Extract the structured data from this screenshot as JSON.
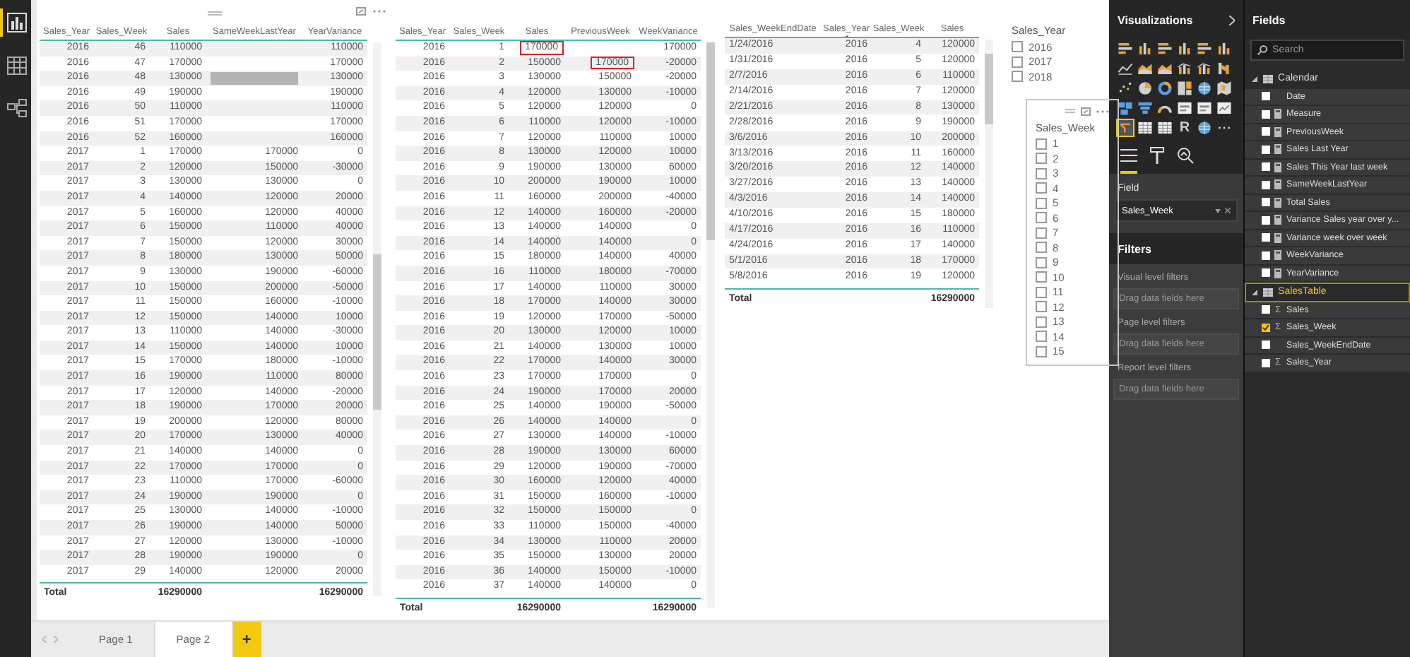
{
  "nav": [
    {
      "kind": "report",
      "selected": true
    },
    {
      "kind": "data",
      "selected": false
    },
    {
      "kind": "model",
      "selected": false
    }
  ],
  "left_table": {
    "columns": [
      {
        "label": "Sales_Year"
      },
      {
        "label": "Sales_Week"
      },
      {
        "label": "Sales"
      },
      {
        "label": "SameWeekLastYear"
      },
      {
        "label": "YearVariance"
      }
    ],
    "rows": [
      {
        "cells": [
          "2016",
          "46",
          "110000",
          null,
          "110000"
        ]
      },
      {
        "cells": [
          "2016",
          "47",
          "170000",
          null,
          "170000"
        ]
      },
      {
        "cells": [
          "2016",
          "48",
          "130000",
          {
            "highlighted": true
          },
          "130000"
        ]
      },
      {
        "cells": [
          "2016",
          "49",
          "190000",
          null,
          "190000"
        ]
      },
      {
        "cells": [
          "2016",
          "50",
          "110000",
          null,
          "110000"
        ]
      },
      {
        "cells": [
          "2016",
          "51",
          "170000",
          null,
          "170000"
        ]
      },
      {
        "cells": [
          "2016",
          "52",
          "160000",
          null,
          "160000"
        ]
      },
      {
        "cells": [
          "2017",
          "1",
          "170000",
          "170000",
          "0"
        ]
      },
      {
        "cells": [
          "2017",
          "2",
          "120000",
          "150000",
          "-30000"
        ]
      },
      {
        "cells": [
          "2017",
          "3",
          "130000",
          "130000",
          "0"
        ]
      },
      {
        "cells": [
          "2017",
          "4",
          "140000",
          "120000",
          "20000"
        ]
      },
      {
        "cells": [
          "2017",
          "5",
          "160000",
          "120000",
          "40000"
        ]
      },
      {
        "cells": [
          "2017",
          "6",
          "150000",
          "110000",
          "40000"
        ]
      },
      {
        "cells": [
          "2017",
          "7",
          "150000",
          "120000",
          "30000"
        ]
      },
      {
        "cells": [
          "2017",
          "8",
          "180000",
          "130000",
          "50000"
        ]
      },
      {
        "cells": [
          "2017",
          "9",
          "130000",
          "190000",
          "-60000"
        ]
      },
      {
        "cells": [
          "2017",
          "10",
          "150000",
          "200000",
          "-50000"
        ]
      },
      {
        "cells": [
          "2017",
          "11",
          "150000",
          "160000",
          "-10000"
        ]
      },
      {
        "cells": [
          "2017",
          "12",
          "150000",
          "140000",
          "10000"
        ]
      },
      {
        "cells": [
          "2017",
          "13",
          "110000",
          "140000",
          "-30000"
        ]
      },
      {
        "cells": [
          "2017",
          "14",
          "150000",
          "140000",
          "10000"
        ]
      },
      {
        "cells": [
          "2017",
          "15",
          "170000",
          "180000",
          "-10000"
        ]
      },
      {
        "cells": [
          "2017",
          "16",
          "190000",
          "110000",
          "80000"
        ]
      },
      {
        "cells": [
          "2017",
          "17",
          "120000",
          "140000",
          "-20000"
        ]
      },
      {
        "cells": [
          "2017",
          "18",
          "190000",
          "170000",
          "20000"
        ]
      },
      {
        "cells": [
          "2017",
          "19",
          "200000",
          "120000",
          "80000"
        ]
      },
      {
        "cells": [
          "2017",
          "20",
          "170000",
          "130000",
          "40000"
        ]
      },
      {
        "cells": [
          "2017",
          "21",
          "140000",
          "140000",
          "0"
        ]
      },
      {
        "cells": [
          "2017",
          "22",
          "170000",
          "170000",
          "0"
        ]
      },
      {
        "cells": [
          "2017",
          "23",
          "110000",
          "170000",
          "-60000"
        ]
      },
      {
        "cells": [
          "2017",
          "24",
          "190000",
          "190000",
          "0"
        ]
      },
      {
        "cells": [
          "2017",
          "25",
          "130000",
          "140000",
          "-10000"
        ]
      },
      {
        "cells": [
          "2017",
          "26",
          "190000",
          "140000",
          "50000"
        ]
      },
      {
        "cells": [
          "2017",
          "27",
          "120000",
          "130000",
          "-10000"
        ]
      },
      {
        "cells": [
          "2017",
          "28",
          "190000",
          "190000",
          "0"
        ]
      },
      {
        "cells": [
          "2017",
          "29",
          "140000",
          "120000",
          "20000"
        ]
      }
    ],
    "total": {
      "label": "Total",
      "sales": "16290000",
      "variance": "16290000"
    }
  },
  "middle_table": {
    "columns": [
      {
        "label": "Sales_Year"
      },
      {
        "label": "Sales_Week"
      },
      {
        "label": "Sales"
      },
      {
        "label": "PreviousWeek"
      },
      {
        "label": "WeekVariance"
      }
    ],
    "rows": [
      {
        "cells": [
          "2016",
          "1",
          {
            "text": "170000",
            "boxed": true
          },
          null,
          "170000"
        ]
      },
      {
        "cells": [
          "2016",
          "2",
          "150000",
          {
            "text": "170000",
            "boxed": true
          },
          "-20000"
        ]
      },
      {
        "cells": [
          "2016",
          "3",
          "130000",
          "150000",
          "-20000"
        ]
      },
      {
        "cells": [
          "2016",
          "4",
          "120000",
          "130000",
          "-10000"
        ]
      },
      {
        "cells": [
          "2016",
          "5",
          "120000",
          "120000",
          "0"
        ]
      },
      {
        "cells": [
          "2016",
          "6",
          "110000",
          "120000",
          "-10000"
        ]
      },
      {
        "cells": [
          "2016",
          "7",
          "120000",
          "110000",
          "10000"
        ]
      },
      {
        "cells": [
          "2016",
          "8",
          "130000",
          "120000",
          "10000"
        ]
      },
      {
        "cells": [
          "2016",
          "9",
          "190000",
          "130000",
          "60000"
        ]
      },
      {
        "cells": [
          "2016",
          "10",
          "200000",
          "190000",
          "10000"
        ]
      },
      {
        "cells": [
          "2016",
          "11",
          "160000",
          "200000",
          "-40000"
        ]
      },
      {
        "cells": [
          "2016",
          "12",
          "140000",
          "160000",
          "-20000"
        ]
      },
      {
        "cells": [
          "2016",
          "13",
          "140000",
          "140000",
          "0"
        ]
      },
      {
        "cells": [
          "2016",
          "14",
          "140000",
          "140000",
          "0"
        ]
      },
      {
        "cells": [
          "2016",
          "15",
          "180000",
          "140000",
          "40000"
        ]
      },
      {
        "cells": [
          "2016",
          "16",
          "110000",
          "180000",
          "-70000"
        ]
      },
      {
        "cells": [
          "2016",
          "17",
          "140000",
          "110000",
          "30000"
        ]
      },
      {
        "cells": [
          "2016",
          "18",
          "170000",
          "140000",
          "30000"
        ]
      },
      {
        "cells": [
          "2016",
          "19",
          "120000",
          "170000",
          "-50000"
        ]
      },
      {
        "cells": [
          "2016",
          "20",
          "130000",
          "120000",
          "10000"
        ]
      },
      {
        "cells": [
          "2016",
          "21",
          "140000",
          "130000",
          "10000"
        ]
      },
      {
        "cells": [
          "2016",
          "22",
          "170000",
          "140000",
          "30000"
        ]
      },
      {
        "cells": [
          "2016",
          "23",
          "170000",
          "170000",
          "0"
        ]
      },
      {
        "cells": [
          "2016",
          "24",
          "190000",
          "170000",
          "20000"
        ]
      },
      {
        "cells": [
          "2016",
          "25",
          "140000",
          "190000",
          "-50000"
        ]
      },
      {
        "cells": [
          "2016",
          "26",
          "140000",
          "140000",
          "0"
        ]
      },
      {
        "cells": [
          "2016",
          "27",
          "130000",
          "140000",
          "-10000"
        ]
      },
      {
        "cells": [
          "2016",
          "28",
          "190000",
          "130000",
          "60000"
        ]
      },
      {
        "cells": [
          "2016",
          "29",
          "120000",
          "190000",
          "-70000"
        ]
      },
      {
        "cells": [
          "2016",
          "30",
          "160000",
          "120000",
          "40000"
        ]
      },
      {
        "cells": [
          "2016",
          "31",
          "150000",
          "160000",
          "-10000"
        ]
      },
      {
        "cells": [
          "2016",
          "32",
          "150000",
          "150000",
          "0"
        ]
      },
      {
        "cells": [
          "2016",
          "33",
          "110000",
          "150000",
          "-40000"
        ]
      },
      {
        "cells": [
          "2016",
          "34",
          "130000",
          "110000",
          "20000"
        ]
      },
      {
        "cells": [
          "2016",
          "35",
          "150000",
          "130000",
          "20000"
        ]
      },
      {
        "cells": [
          "2016",
          "36",
          "140000",
          "150000",
          "-10000"
        ]
      },
      {
        "cells": [
          "2016",
          "37",
          "140000",
          "140000",
          "0"
        ]
      }
    ],
    "total": {
      "label": "Total",
      "sales": "16290000",
      "variance": "16290000"
    }
  },
  "right_table": {
    "columns": [
      {
        "label": "Sales_WeekEndDate",
        "sorted": false
      },
      {
        "label": "Sales_Year",
        "sorted": true
      },
      {
        "label": "Sales_Week",
        "sorted": false
      },
      {
        "label": "Sales",
        "sorted": false
      }
    ],
    "rows": [
      {
        "cells": [
          "1/24/2016",
          "2016",
          "4",
          "120000"
        ]
      },
      {
        "cells": [
          "1/31/2016",
          "2016",
          "5",
          "120000"
        ]
      },
      {
        "cells": [
          "2/7/2016",
          "2016",
          "6",
          "110000"
        ]
      },
      {
        "cells": [
          "2/14/2016",
          "2016",
          "7",
          "120000"
        ]
      },
      {
        "cells": [
          "2/21/2016",
          "2016",
          "8",
          "130000"
        ]
      },
      {
        "cells": [
          "2/28/2016",
          "2016",
          "9",
          "190000"
        ]
      },
      {
        "cells": [
          "3/6/2016",
          "2016",
          "10",
          "200000"
        ]
      },
      {
        "cells": [
          "3/13/2016",
          "2016",
          "11",
          "160000"
        ]
      },
      {
        "cells": [
          "3/20/2016",
          "2016",
          "12",
          "140000"
        ]
      },
      {
        "cells": [
          "3/27/2016",
          "2016",
          "13",
          "140000"
        ]
      },
      {
        "cells": [
          "4/3/2016",
          "2016",
          "14",
          "140000"
        ]
      },
      {
        "cells": [
          "4/10/2016",
          "2016",
          "15",
          "180000"
        ]
      },
      {
        "cells": [
          "4/17/2016",
          "2016",
          "16",
          "110000"
        ]
      },
      {
        "cells": [
          "4/24/2016",
          "2016",
          "17",
          "140000"
        ]
      },
      {
        "cells": [
          "5/1/2016",
          "2016",
          "18",
          "170000"
        ]
      },
      {
        "cells": [
          "5/8/2016",
          "2016",
          "19",
          "120000"
        ]
      }
    ],
    "total": {
      "label": "Total",
      "sales": "16290000"
    }
  },
  "year_slicer": {
    "title": "Sales_Year",
    "items": [
      {
        "label": "2016",
        "checked": false
      },
      {
        "label": "2017",
        "checked": false
      },
      {
        "label": "2018",
        "checked": false
      }
    ]
  },
  "week_slicer": {
    "title": "Sales_Week",
    "items": [
      {
        "label": "1",
        "checked": false
      },
      {
        "label": "2",
        "checked": false
      },
      {
        "label": "3",
        "checked": false
      },
      {
        "label": "4",
        "checked": false
      },
      {
        "label": "5",
        "checked": false
      },
      {
        "label": "6",
        "checked": false
      },
      {
        "label": "7",
        "checked": false
      },
      {
        "label": "8",
        "checked": false
      },
      {
        "label": "9",
        "checked": false
      },
      {
        "label": "10",
        "checked": false
      },
      {
        "label": "11",
        "checked": false
      },
      {
        "label": "12",
        "checked": false
      },
      {
        "label": "13",
        "checked": false
      },
      {
        "label": "14",
        "checked": false
      },
      {
        "label": "15",
        "checked": false
      }
    ]
  },
  "pages": {
    "tabs": [
      {
        "label": "Page 1",
        "selected": false
      },
      {
        "label": "Page 2",
        "selected": true
      }
    ],
    "add_label": "+"
  },
  "visualizations": {
    "title": "Visualizations",
    "gallery": [
      {
        "kind": "bar",
        "selected": false
      },
      {
        "kind": "column",
        "selected": false
      },
      {
        "kind": "bar",
        "selected": false
      },
      {
        "kind": "column",
        "selected": false
      },
      {
        "kind": "bar",
        "selected": false
      },
      {
        "kind": "column",
        "selected": false
      },
      {
        "kind": "line",
        "selected": false
      },
      {
        "kind": "area",
        "selected": false
      },
      {
        "kind": "area",
        "selected": false
      },
      {
        "kind": "combo",
        "selected": false
      },
      {
        "kind": "combo",
        "selected": false
      },
      {
        "kind": "ribbon",
        "selected": false
      },
      {
        "kind": "scatter",
        "selected": false
      },
      {
        "kind": "pie",
        "selected": false
      },
      {
        "kind": "donut",
        "selected": false
      },
      {
        "kind": "treemap",
        "selected": false
      },
      {
        "kind": "globe",
        "selected": false
      },
      {
        "kind": "map",
        "selected": false
      },
      {
        "kind": "shapes",
        "selected": false
      },
      {
        "kind": "funnel",
        "selected": false
      },
      {
        "kind": "gauge",
        "selected": false
      },
      {
        "kind": "card",
        "selected": false
      },
      {
        "kind": "card",
        "selected": false
      },
      {
        "kind": "kpi",
        "selected": false
      },
      {
        "kind": "slicer",
        "selected": true
      },
      {
        "kind": "table",
        "selected": false
      },
      {
        "kind": "table",
        "selected": false
      },
      {
        "kind": "script",
        "label": "R",
        "selected": false
      },
      {
        "kind": "globe",
        "selected": false
      },
      {
        "kind": "more",
        "selected": false
      }
    ],
    "pane_tabs": [
      {
        "kind": "fields",
        "selected": true
      },
      {
        "kind": "format",
        "selected": false
      },
      {
        "kind": "analytics",
        "selected": false
      }
    ],
    "well_label": "Field",
    "well_value": "Sales_Week",
    "filters_title": "Filters",
    "filters": [
      {
        "label": "Visual level filters",
        "drop_hint": "Drag data fields here"
      },
      {
        "label": "Page level filters",
        "drop_hint": "Drag data fields here"
      },
      {
        "label": "Report level filters",
        "drop_hint": "Drag data fields here"
      }
    ]
  },
  "fields": {
    "title": "Fields",
    "search": {
      "placeholder": "Search"
    },
    "tables": [
      {
        "name": "Calendar",
        "expanded": true,
        "selected": false,
        "children": [
          {
            "label": "Date",
            "kind": "column",
            "checked": false
          },
          {
            "label": "Measure",
            "kind": "measure",
            "checked": false
          },
          {
            "label": "PreviousWeek",
            "kind": "measure",
            "checked": false
          },
          {
            "label": "Sales Last Year",
            "kind": "measure",
            "checked": false
          },
          {
            "label": "Sales This Year last week",
            "kind": "measure",
            "checked": false
          },
          {
            "label": "SameWeekLastYear",
            "kind": "measure",
            "checked": false
          },
          {
            "label": "Total Sales",
            "kind": "measure",
            "checked": false
          },
          {
            "label": "Variance Sales year over y...",
            "kind": "measure",
            "checked": false
          },
          {
            "label": "Variance week over week",
            "kind": "measure",
            "checked": false
          },
          {
            "label": "WeekVariance",
            "kind": "measure",
            "checked": false
          },
          {
            "label": "YearVariance",
            "kind": "measure",
            "checked": false
          }
        ]
      },
      {
        "name": "SalesTable",
        "expanded": true,
        "selected": true,
        "children": [
          {
            "label": "Sales",
            "kind": "sum",
            "symbol": "Σ",
            "checked": false
          },
          {
            "label": "Sales_Week",
            "kind": "sum",
            "symbol": "Σ",
            "checked": true
          },
          {
            "label": "Sales_WeekEndDate",
            "kind": "column",
            "checked": false
          },
          {
            "label": "Sales_Year",
            "kind": "sum",
            "symbol": "Σ",
            "checked": false
          }
        ]
      }
    ]
  }
}
